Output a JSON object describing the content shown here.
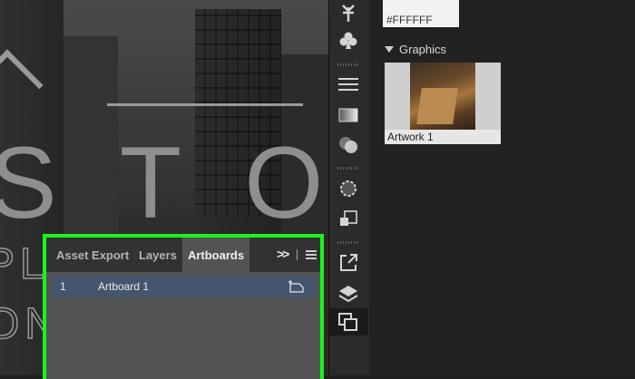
{
  "canvas": {
    "big_text": "S T O T",
    "line2": "PL",
    "line3": "ON"
  },
  "panel": {
    "tabs": [
      {
        "label": "Asset Export",
        "active": false
      },
      {
        "label": "Layers",
        "active": false
      },
      {
        "label": "Artboards",
        "active": true
      }
    ],
    "more_label": ">>",
    "artboards": [
      {
        "num": "1",
        "name": "Artboard 1"
      }
    ],
    "highlight_color": "#1cf21c"
  },
  "toolbar": {
    "icons": [
      "puppet-warp-icon",
      "club-symbol-icon",
      "stroke-icon",
      "gradient-icon",
      "transparency-icon",
      "appearance-icon",
      "graphic-styles-icon",
      "export-icon",
      "layers-icon",
      "artboards-icon"
    ]
  },
  "properties": {
    "swatch_value": "#FFFFFF",
    "graphics_header": "Graphics",
    "graphic_item": "Artwork 1"
  }
}
